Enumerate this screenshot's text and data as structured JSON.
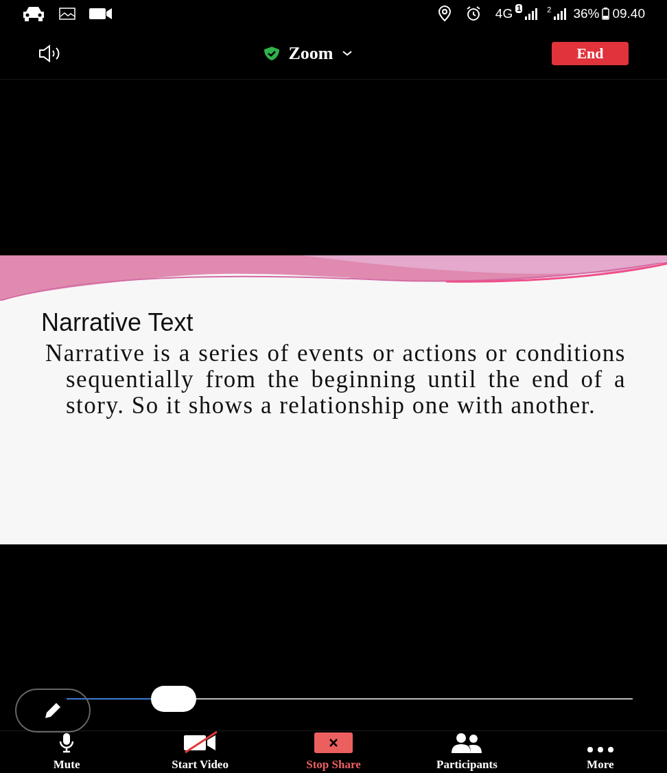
{
  "status_bar": {
    "network": "4G",
    "sim1": "1",
    "sim2": "2",
    "battery": "36%",
    "time": "09.40"
  },
  "header": {
    "title": "Zoom",
    "end_button": "End"
  },
  "slide": {
    "title": "Narrative Text",
    "body": "Narrative is a series of events or actions or conditions sequentially from the beginning until the end of a story. So it shows a relationship one with another."
  },
  "annotation_slider": {
    "level": 0.19
  },
  "toolbar": [
    {
      "kind": "mic",
      "label": "Mute",
      "active": false
    },
    {
      "kind": "video-off",
      "label": "Start Video",
      "active": false
    },
    {
      "kind": "stop-share",
      "label": "Stop Share",
      "active": true
    },
    {
      "kind": "participants",
      "label": "Participants",
      "active": false
    },
    {
      "kind": "more",
      "label": "More",
      "active": false
    }
  ]
}
